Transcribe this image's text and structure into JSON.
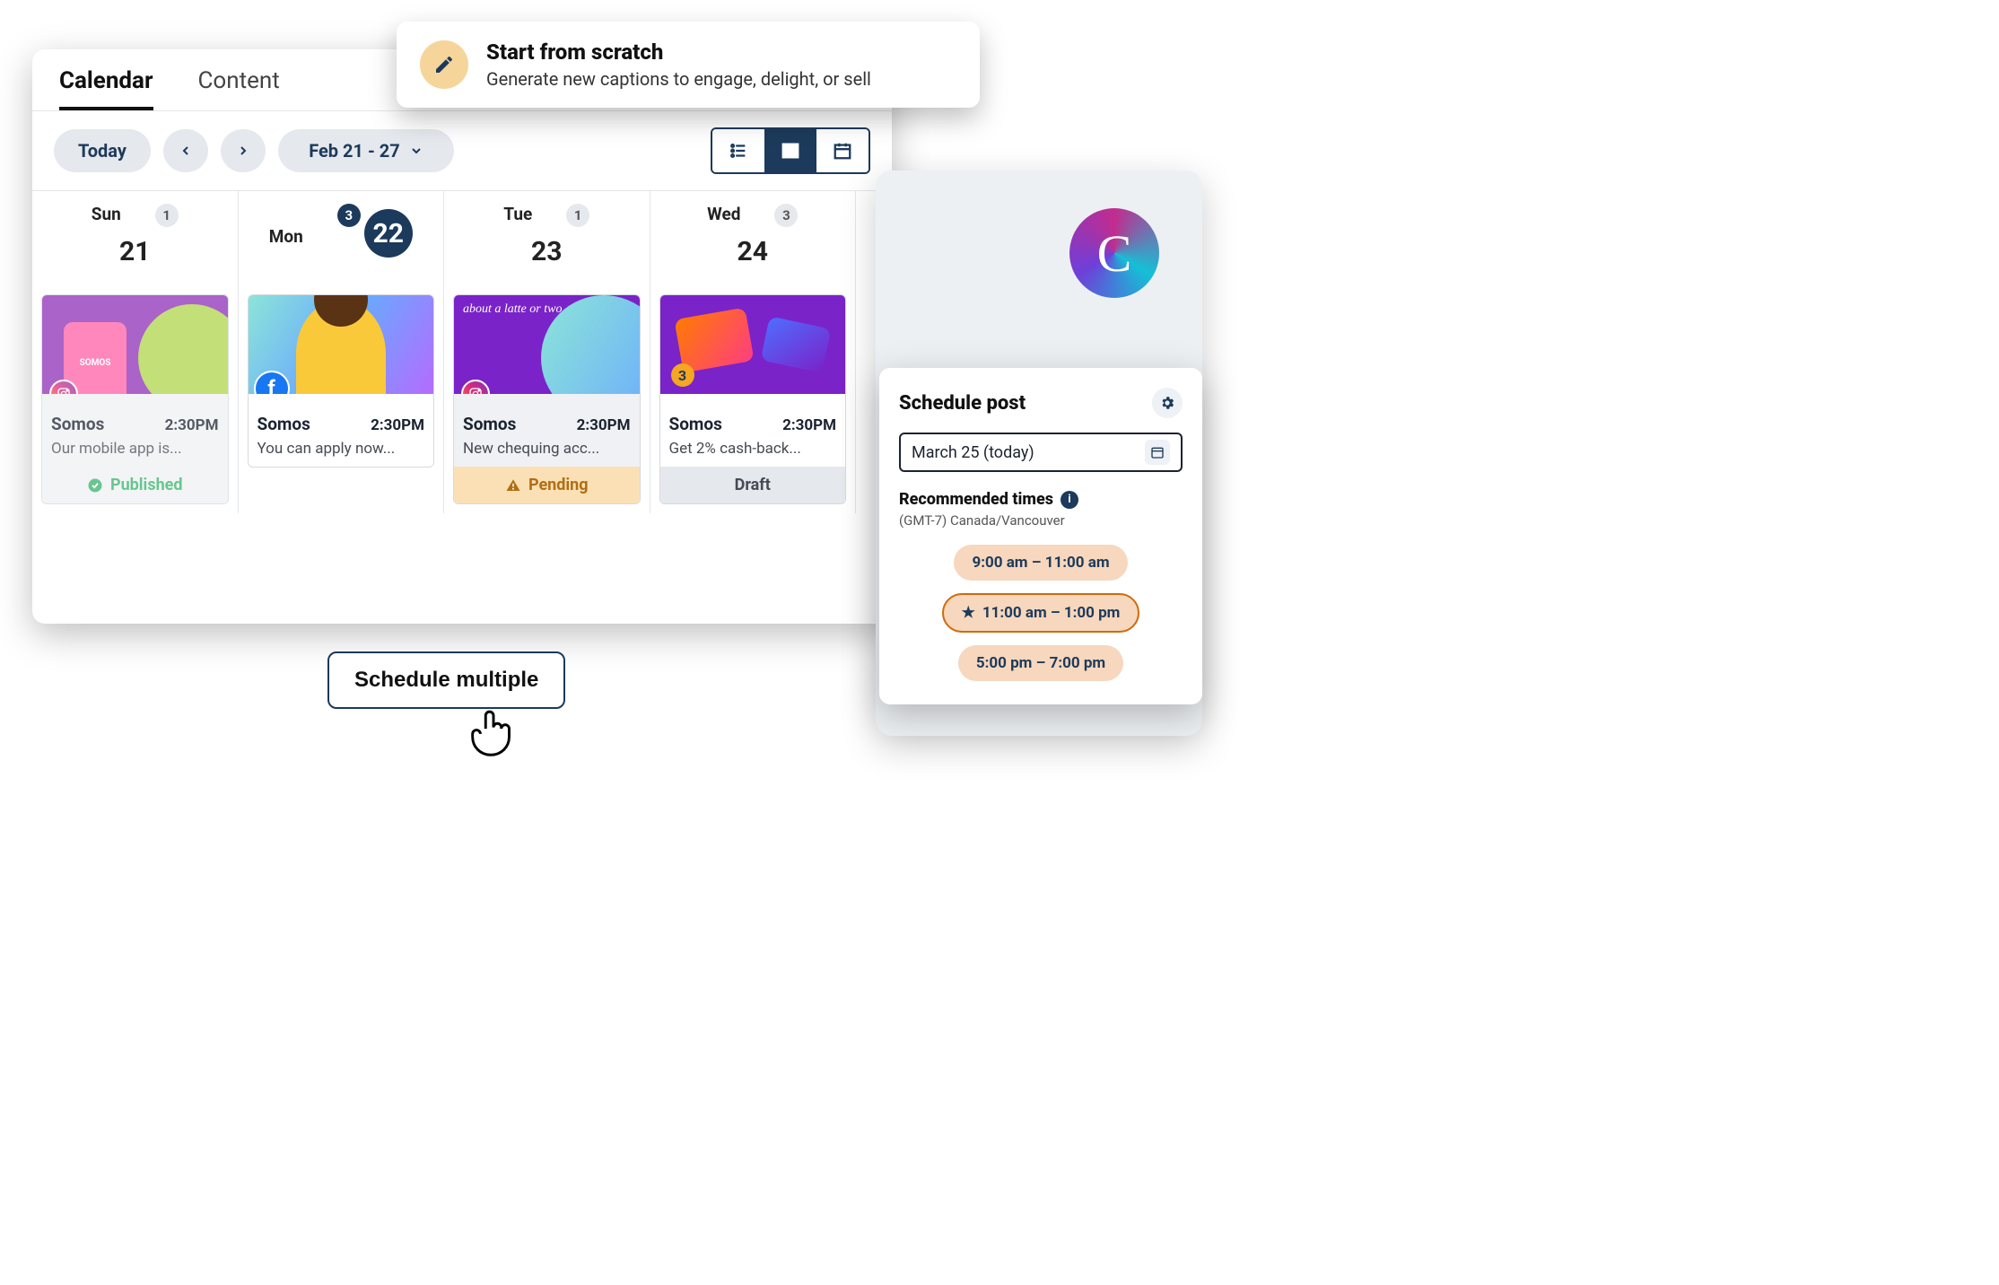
{
  "tabs": {
    "calendar": "Calendar",
    "content": "Content"
  },
  "toolbar": {
    "today": "Today",
    "range": "Feb 21 - 27"
  },
  "days": [
    {
      "name": "Sun",
      "date": "21",
      "count": 1,
      "today": false
    },
    {
      "name": "Mon",
      "date": "22",
      "count": 3,
      "today": true
    },
    {
      "name": "Tue",
      "date": "23",
      "count": 1,
      "today": false
    },
    {
      "name": "Wed",
      "date": "24",
      "count": 3,
      "today": false
    }
  ],
  "cards": [
    {
      "thumb": "t0",
      "network": "ig",
      "title": "Somos",
      "time": "2:30PM",
      "text": "Our mobile app is...",
      "status": "Published",
      "thumb_label": ""
    },
    {
      "thumb": "t1",
      "network": "fb",
      "title": "Somos",
      "time": "2:30PM",
      "text": "You can apply now...",
      "status": "",
      "thumb_label": ""
    },
    {
      "thumb": "t2",
      "network": "ig",
      "title": "Somos",
      "time": "2:30PM",
      "text": "New chequing acc...",
      "status": "Pending",
      "thumb_label": "about a latte\nor two."
    },
    {
      "thumb": "t3",
      "network": "",
      "title": "Somos",
      "time": "2:30PM",
      "text": "Get 2% cash-back...",
      "status": "Draft",
      "thumb_label": "",
      "multi": 3
    }
  ],
  "callout": {
    "title": "Start from scratch",
    "sub": "Generate new captions to engage, delight, or sell"
  },
  "schedule_button": "Schedule multiple",
  "schedule_panel": {
    "title": "Schedule post",
    "date": "March 25 (today)",
    "rec_title": "Recommended times",
    "timezone": "(GMT-7) Canada/Vancouver",
    "slots": [
      {
        "label": "9:00 am – 11:00 am",
        "star": false
      },
      {
        "label": "11:00 am – 1:00 pm",
        "star": true
      },
      {
        "label": "5:00 pm – 7:00 pm",
        "star": false
      }
    ]
  },
  "canva_letter": "C"
}
